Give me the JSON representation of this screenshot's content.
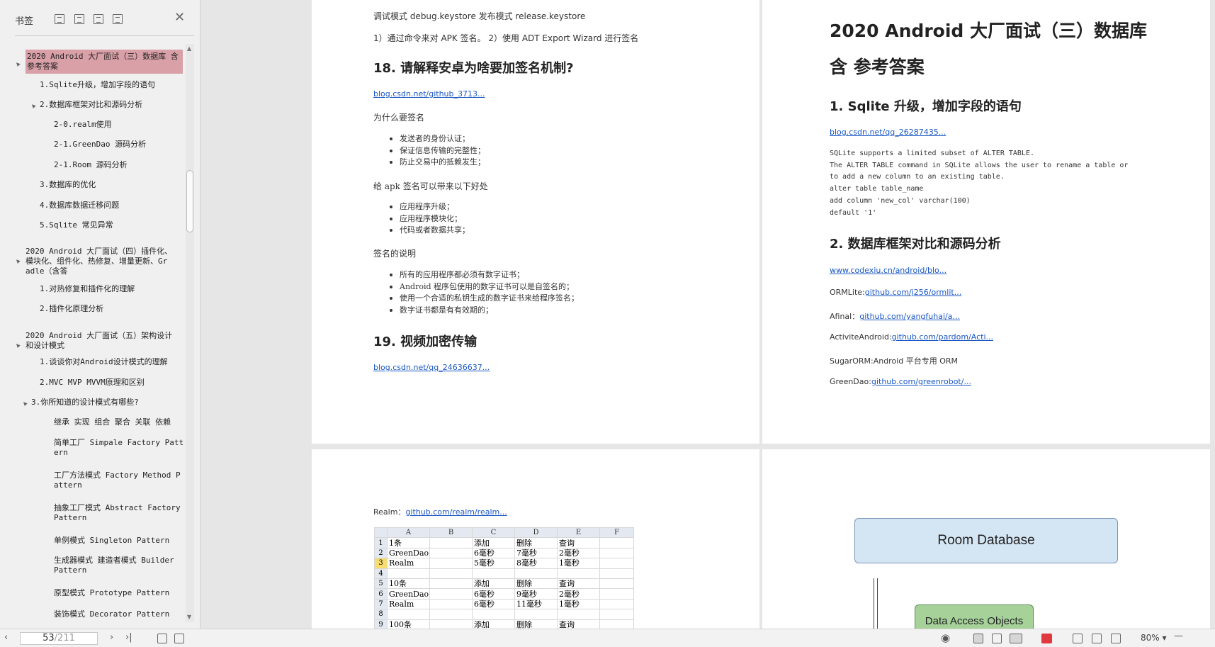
{
  "sidebar": {
    "title": "书签",
    "tree": [
      {
        "label": "2020 Android 大厂面试（三）数据库 含参考答案",
        "lines": [
          "2020 Android 大厂面试（三）数据库 含",
          "参考答案"
        ],
        "selected": true,
        "twisty": "▲"
      },
      {
        "label": "1.Sqlite升级，增加字段的语句"
      },
      {
        "label": "2.数据库框架对比和源码分析",
        "twisty": "▲"
      },
      {
        "label": "2-0.realm使用"
      },
      {
        "label": "2-1.GreenDao 源码分析"
      },
      {
        "label": "2-1.Room 源码分析"
      },
      {
        "label": "3.数据库的优化"
      },
      {
        "label": "4.数据库数据迁移问题"
      },
      {
        "label": "5.Sqlite 常见异常"
      },
      {
        "label": "2020 Android 大厂面试（四）插件化、模块化、组件化、热修复、增量更新、Gradle（含答",
        "lines": [
          "2020 Android 大厂面试（四）插件化、",
          "模块化、组件化、热修复、增量更新、Gr",
          "adle（含答"
        ],
        "twisty": "▲"
      },
      {
        "label": "1.对热修复和插件化的理解"
      },
      {
        "label": "2.插件化原理分析"
      },
      {
        "label": "2020 Android 大厂面试（五）架构设计和设计模式",
        "lines": [
          "2020 Android 大厂面试（五）架构设计",
          "和设计模式"
        ],
        "twisty": "▲"
      },
      {
        "label": "1.谈谈你对Android设计模式的理解"
      },
      {
        "label": "2.MVC MVP MVVM原理和区别"
      },
      {
        "label": "3.你所知道的设计模式有哪些?",
        "twisty": "▲"
      },
      {
        "label": "继承 实现 组合 聚合 关联 依赖"
      },
      {
        "label": "简单工厂 Simpale Factory Pattern",
        "lines": [
          "简单工厂 Simpale Factory Patt",
          "ern"
        ]
      },
      {
        "label": "工厂方法模式 Factory Method Pattern",
        "lines": [
          "工厂方法模式 Factory Method P",
          "attern"
        ]
      },
      {
        "label": "抽象工厂模式 Abstract Factory Pattern",
        "lines": [
          "抽象工厂模式 Abstract Factory",
          "Pattern"
        ]
      },
      {
        "label": "单例模式 Singleton Pattern"
      },
      {
        "label": "生成器模式 建造者模式 Builder Pattern",
        "lines": [
          "生成器模式 建造者模式 Builder",
          "Pattern"
        ]
      },
      {
        "label": "原型模式 Prototype Pattern"
      },
      {
        "label": "装饰模式 Decorator Pattern"
      }
    ]
  },
  "page_left_top": {
    "line1": "调试模式  debug.keystore  发布模式  release.keystore",
    "line2": "1）通过命令来对 APK 签名。 2）使用 ADT Export Wizard 进行签名",
    "h18": "18. 请解释安卓为啥要加签名机制?",
    "link18": "blog.csdn.net/github_3713...",
    "why": "为什么要签名",
    "why_items": [
      "发送者的身份认证；",
      "保证信息传输的完整性；",
      "防止交易中的抵赖发生；"
    ],
    "benefit": "给 apk 签名可以带来以下好处",
    "benefit_items": [
      "应用程序升级；",
      "应用程序模块化；",
      "代码或者数据共享；"
    ],
    "explain": "签名的说明",
    "explain_items": [
      "所有的应用程序都必须有数字证书；",
      "Android  程序包使用的数字证书可以是自签名的；",
      "使用一个合适的私钥生成的数字证书来给程序签名；",
      "数字证书都是有有效期的；"
    ],
    "h19": "19. 视频加密传输",
    "link19": "blog.csdn.net/qq_24636637..."
  },
  "page_right_top": {
    "title1": "2020 Android  大厂面试（三）数据库",
    "title2": "含  参考答案",
    "h1": "1. Sqlite 升级，增加字段的语句",
    "link1": "blog.csdn.net/qq_26287435...",
    "code": [
      "SQLite supports a limited subset of ALTER TABLE.",
      "The ALTER TABLE command in SQLite allows the user to rename a table or",
      "to add a new column to an existing table.",
      "alter table table_name",
      "add column 'new_col' varchar(100)",
      "default '1'"
    ],
    "h2": "2. 数据库框架对比和源码分析",
    "link2": "www.codexiu.cn/android/blo...",
    "ormlite_label": "ORMLite:",
    "ormlite_link": "github.com/j256/ormlit...",
    "afinal_label": "Afinal：",
    "afinal_link": "github.com/yangfuhai/a...",
    "activeandroid_label": "ActiviteAndroid:",
    "activeandroid_link": "github.com/pardom/Acti...",
    "sugar": "SugarORM:Android  平台专用 ORM",
    "greendao_label": "GreenDao:",
    "greendao_link": "github.com/greenrobot/..."
  },
  "page_left_bottom": {
    "realm_label": "Realm：",
    "realm_link": "github.com/realm/realm...",
    "sheet_header": [
      "",
      "A",
      "B",
      "C",
      "D",
      "E",
      "F"
    ],
    "sheet_rows": [
      [
        "1",
        "1条",
        "",
        "添加",
        "删除",
        "查询",
        ""
      ],
      [
        "2",
        "GreenDao",
        "",
        "6毫秒",
        "7毫秒",
        "2毫秒",
        ""
      ],
      [
        "3",
        "Realm",
        "",
        "5毫秒",
        "8毫秒",
        "1毫秒",
        ""
      ],
      [
        "4",
        "",
        "",
        "",
        "",
        "",
        ""
      ],
      [
        "5",
        "10条",
        "",
        "添加",
        "删除",
        "查询",
        ""
      ],
      [
        "6",
        "GreenDao",
        "",
        "6毫秒",
        "9毫秒",
        "2毫秒",
        ""
      ],
      [
        "7",
        "Realm",
        "",
        "6毫秒",
        "11毫秒",
        "1毫秒",
        ""
      ],
      [
        "8",
        "",
        "",
        "",
        "",
        "",
        ""
      ],
      [
        "9",
        "100条",
        "",
        "添加",
        "删除",
        "查询",
        ""
      ]
    ]
  },
  "page_right_bottom": {
    "room_db": "Room Database",
    "dao": "Data Access Objects"
  },
  "status": {
    "current_page": "53",
    "total_pages": "/211",
    "zoom": "80%"
  }
}
